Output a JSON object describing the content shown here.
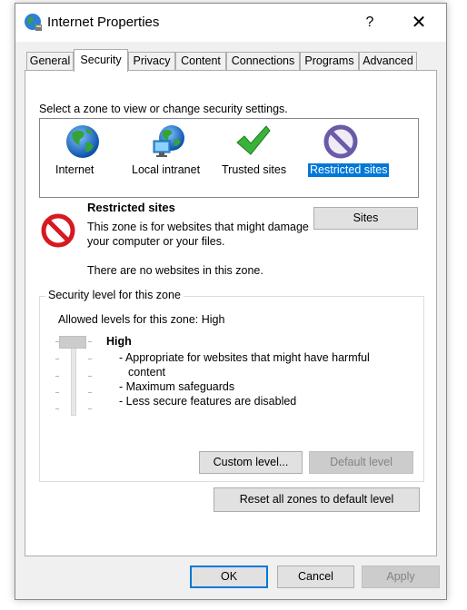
{
  "window": {
    "title": "Internet Properties",
    "help_label": "?",
    "close_glyph": "✕"
  },
  "tabs": [
    {
      "label": "General"
    },
    {
      "label": "Security"
    },
    {
      "label": "Privacy"
    },
    {
      "label": "Content"
    },
    {
      "label": "Connections"
    },
    {
      "label": "Programs"
    },
    {
      "label": "Advanced"
    }
  ],
  "active_tab": "Security",
  "security": {
    "zone_prompt": "Select a zone to view or change security settings.",
    "zones": [
      {
        "label": "Internet",
        "icon": "globe-icon"
      },
      {
        "label": "Local intranet",
        "icon": "network-globe-icon"
      },
      {
        "label": "Trusted sites",
        "icon": "checkmark-icon"
      },
      {
        "label": "Restricted sites",
        "icon": "restricted-icon",
        "selected": true
      }
    ],
    "selected_zone": {
      "title": "Restricted sites",
      "description": "This zone is for websites that might damage your computer or your files.",
      "note": "There are no websites in this zone.",
      "sites_button": "Sites"
    },
    "level_group": {
      "legend": "Security level for this zone",
      "allowed": "Allowed levels for this zone: High",
      "level_name": "High",
      "level_position": 0,
      "bullets": [
        "- Appropriate for websites that might have harmful content",
        "- Maximum safeguards",
        "- Less secure features are disabled"
      ],
      "custom_level_button": "Custom level...",
      "default_level_button": "Default level"
    },
    "reset_button": "Reset all zones to default level"
  },
  "footer": {
    "ok": "OK",
    "cancel": "Cancel",
    "apply": "Apply"
  },
  "colors": {
    "selection": "#0078d7",
    "restricted_red": "#d71a21",
    "restricted_purple": "#6a5aa8",
    "check_green": "#3ab23a"
  }
}
